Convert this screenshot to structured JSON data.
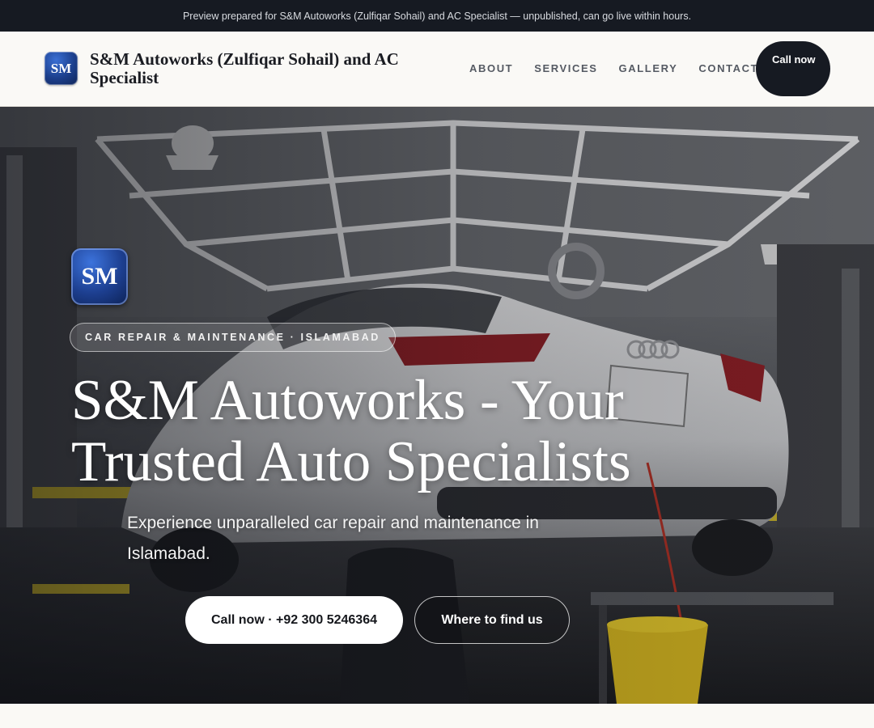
{
  "banner": {
    "text": "Preview prepared for S&M Autoworks (Zulfiqar Sohail) and AC Specialist — unpublished, can go live within hours."
  },
  "header": {
    "logo_initials": "SM",
    "business_name": "S&M Autoworks (Zulfiqar Sohail) and AC Specialist",
    "nav": [
      "ABOUT",
      "SERVICES",
      "GALLERY",
      "CONTACT"
    ],
    "call_button": "Call now"
  },
  "hero": {
    "logo_initials": "SM",
    "eyebrow": "CAR REPAIR & MAINTENANCE · ISLAMABAD",
    "title": "S&M Autoworks - Your Trusted Auto Specialists",
    "subtitle": "Experience unparalleled car repair and maintenance in Islamabad.",
    "primary_cta": "Call now · +92 300 5246364",
    "secondary_cta": "Where to find us",
    "background_photo": "car-on-lift-in-workshop",
    "colors": {
      "dark": "#161a22",
      "brand_blue": "#1c3f8c",
      "white": "#ffffff"
    }
  }
}
